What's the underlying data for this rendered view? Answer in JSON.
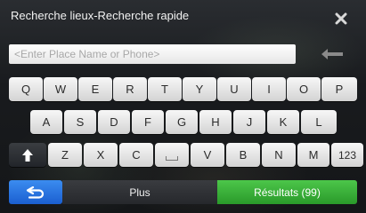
{
  "window": {
    "title": "Recherche lieux-Recherche rapide",
    "close_icon": "close-icon"
  },
  "search": {
    "placeholder": "<Enter Place Name or Phone>",
    "value": "",
    "backspace_icon": "backspace-arrow-icon"
  },
  "keyboard": {
    "row1": [
      "Q",
      "W",
      "E",
      "R",
      "T",
      "Y",
      "U",
      "I",
      "O",
      "P"
    ],
    "row2": [
      "A",
      "S",
      "D",
      "F",
      "G",
      "H",
      "J",
      "K",
      "L"
    ],
    "row3": [
      "Z",
      "X",
      "C",
      "V",
      "B",
      "N",
      "M"
    ],
    "shift_icon": "shift-arrow-icon",
    "space_icon": "space-icon",
    "numbers_label": "123"
  },
  "bottom": {
    "back_icon": "back-arrow-icon",
    "more_label": "Plus",
    "results_label": "Résultats (99)"
  },
  "colors": {
    "back_button": "#2f7fe6",
    "results_button": "#3db43b",
    "key_face": "#e8e8e8",
    "dark_key": "#2c2f33"
  }
}
